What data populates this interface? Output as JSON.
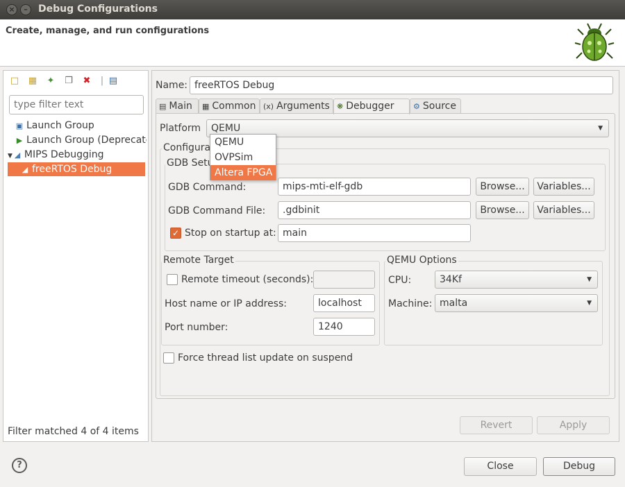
{
  "window": {
    "title": "Debug Configurations",
    "close_icon": "×",
    "minimize_icon": "–"
  },
  "header": {
    "title": "Create, manage, and run configurations"
  },
  "left": {
    "filter_placeholder": "type filter text",
    "tree": [
      {
        "label": "Launch Group"
      },
      {
        "label": "Launch Group (Deprecated)"
      },
      {
        "label": "MIPS Debugging"
      },
      {
        "label": "freeRTOS Debug"
      }
    ],
    "status": "Filter matched 4 of 4 items"
  },
  "right": {
    "name_label": "Name:",
    "name_value": "freeRTOS Debug",
    "tabs": [
      {
        "label": "Main"
      },
      {
        "label": "Common"
      },
      {
        "label": "Arguments"
      },
      {
        "label": "Debugger"
      },
      {
        "label": "Source"
      }
    ],
    "platform_label": "Platform",
    "platform_value": "QEMU",
    "platform_options": [
      "QEMU",
      "OVPSim",
      "Altera FPGA"
    ],
    "config_group_label": "Configura",
    "gdb_group_label": "GDB Setu",
    "gdb_command_label": "GDB Command:",
    "gdb_command_value": "mips-mti-elf-gdb",
    "gdb_command_file_label": "GDB Command File:",
    "gdb_command_file_value": ".gdbinit",
    "browse_label": "Browse...",
    "variables_label": "Variables...",
    "stop_on_startup_label": "Stop on startup at:",
    "stop_on_startup_value": "main",
    "remote_group_label": "Remote Target",
    "remote_timeout_label": "Remote timeout (seconds):",
    "host_label": "Host name or IP address:",
    "host_value": "localhost",
    "port_label": "Port number:",
    "port_value": "1240",
    "qemu_group_label": "QEMU Options",
    "cpu_label": "CPU:",
    "cpu_value": "34Kf",
    "machine_label": "Machine:",
    "machine_value": "malta",
    "force_thread_label": "Force thread list update on suspend",
    "revert_label": "Revert",
    "apply_label": "Apply"
  },
  "footer": {
    "help_label": "?",
    "close_label": "Close",
    "debug_label": "Debug"
  },
  "colors": {
    "accent": "#f07746",
    "checkbox_checked": "#e06a35"
  }
}
